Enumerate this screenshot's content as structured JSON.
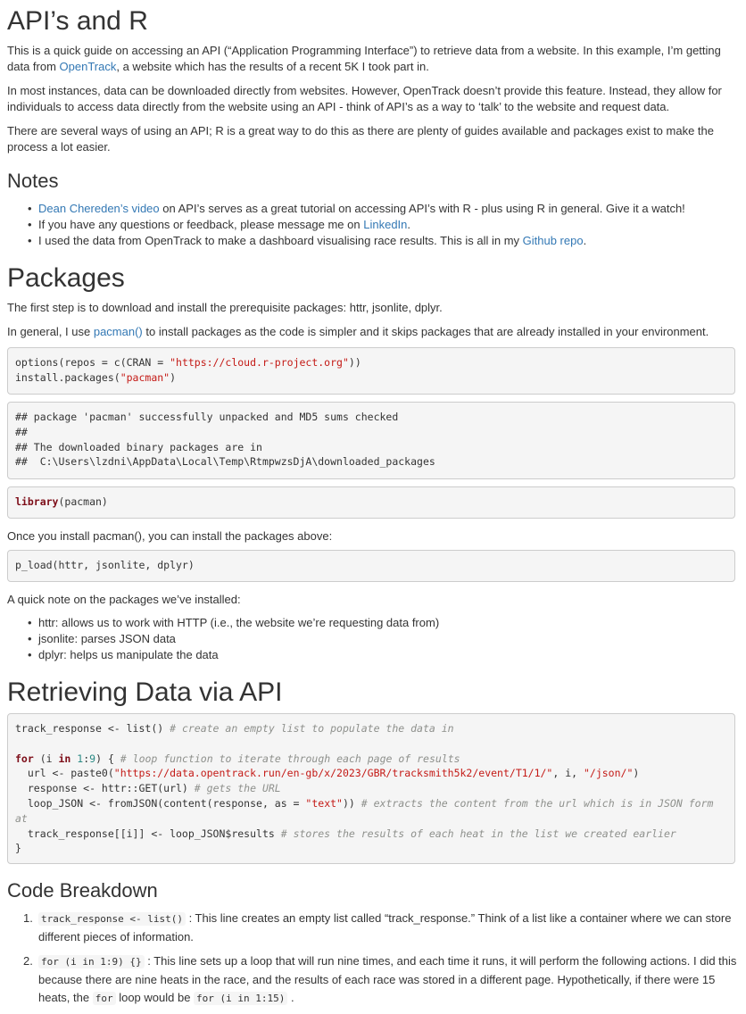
{
  "title": "API’s and R",
  "intro": {
    "p1_before": "This is a quick guide on accessing an API (“Application Programming Interface”) to retrieve data from a website. In this example, I’m getting data from ",
    "p1_link": "OpenTrack",
    "p1_after": ", a website which has the results of a recent 5K I took part in.",
    "p2": "In most instances, data can be downloaded directly from websites. However, OpenTrack doesn’t provide this feature. Instead, they allow for individuals to access data directly from the website using an API - think of API’s as a way to ‘talk’ to the website and request data.",
    "p3": "There are several ways of using an API; R is a great way to do this as there are plenty of guides available and packages exist to make the process a lot easier."
  },
  "notes": {
    "heading": "Notes",
    "items": [
      {
        "link": "Dean Chereden’s video",
        "before": "",
        "after": " on API’s serves as a great tutorial on accessing API’s with R - plus using R in general. Give it a watch!"
      },
      {
        "link": "LinkedIn",
        "before": "If you have any questions or feedback, please message me on ",
        "after": "."
      },
      {
        "link": "Github repo",
        "before": "I used the data from OpenTrack to make a dashboard visualising race results. This is all in my ",
        "after": "."
      }
    ]
  },
  "packages": {
    "heading": "Packages",
    "p1": "The first step is to download and install the prerequisite packages: httr, jsonlite, dplyr.",
    "p2_before": "In general, I use ",
    "p2_link": "pacman()",
    "p2_after": " to install packages as the code is simpler and it skips packages that are already installed in your environment.",
    "code1_line1_a": "options(repos = c(CRAN = ",
    "code1_line1_str": "\"https://cloud.r-project.org\"",
    "code1_line1_b": "))",
    "code1_line2_a": "install.packages(",
    "code1_line2_str": "\"pacman\"",
    "code1_line2_b": ")",
    "output1": "## package 'pacman' successfully unpacked and MD5 sums checked\n##\n## The downloaded binary packages are in\n##  C:\\Users\\lzdni\\AppData\\Local\\Temp\\RtmpwzsDjA\\downloaded_packages",
    "code2_kw": "library",
    "code2_rest": "(pacman)",
    "p3": "Once you install pacman(), you can install the packages above:",
    "code3": "p_load(httr, jsonlite, dplyr)",
    "p4": "A quick note on the packages we’ve installed:",
    "items": [
      "httr: allows us to work with HTTP (i.e., the website we’re requesting data from)",
      "jsonlite: parses JSON data",
      "dplyr: helps us manipulate the data"
    ]
  },
  "retrieving": {
    "heading": "Retrieving Data via API",
    "l1_code": "track_response <- list() ",
    "l1_cm": "# create an empty list to populate the data in",
    "l3_for": "for",
    "l3_a": " (i ",
    "l3_in": "in",
    "l3_sp": " ",
    "l3_n1": "1",
    "l3_colon": ":",
    "l3_n2": "9",
    "l3_b": ") { ",
    "l3_cm": "# loop function to iterate through each page of results",
    "l4_a": "  url <- paste0(",
    "l4_str1": "\"https://data.opentrack.run/en-gb/x/2023/GBR/tracksmith5k2/event/T1/1/\"",
    "l4_b": ", i, ",
    "l4_str2": "\"/json/\"",
    "l4_c": ")",
    "l5_a": "  response <- httr::GET(url) ",
    "l5_cm": "# gets the URL",
    "l6_a": "  loop_JSON <- fromJSON(content(response, as = ",
    "l6_str": "\"text\"",
    "l6_b": ")) ",
    "l6_cm": "# extracts the content from the url which is in JSON form",
    "l7_cm": "at",
    "l8_a": "  track_response[[i]] <- loop_JSON$results ",
    "l8_cm": "# stores the results of each heat in the list we created earlier",
    "l9": "}"
  },
  "breakdown": {
    "heading": "Code Breakdown",
    "item1_num": "1.",
    "item1_code": "track_response <- list()",
    "item1_text": " : This line creates an empty list called “track_response.” Think of a list like a container where we can store different pieces of information.",
    "item2_num": "2.",
    "item2_code": "for (i in 1:9) {}",
    "item2_text": " : This line sets up a loop that will run nine times, and each time it runs, it will perform the following actions. I did this because there are nine heats in the race, and the results of each race was stored in a different page. Hypothetically, if there were 15 heats, the ",
    "item2_code2": "for",
    "item2_text2": " loop would be ",
    "item2_code3": "for (i in 1:15)",
    "item2_text3": " ."
  }
}
